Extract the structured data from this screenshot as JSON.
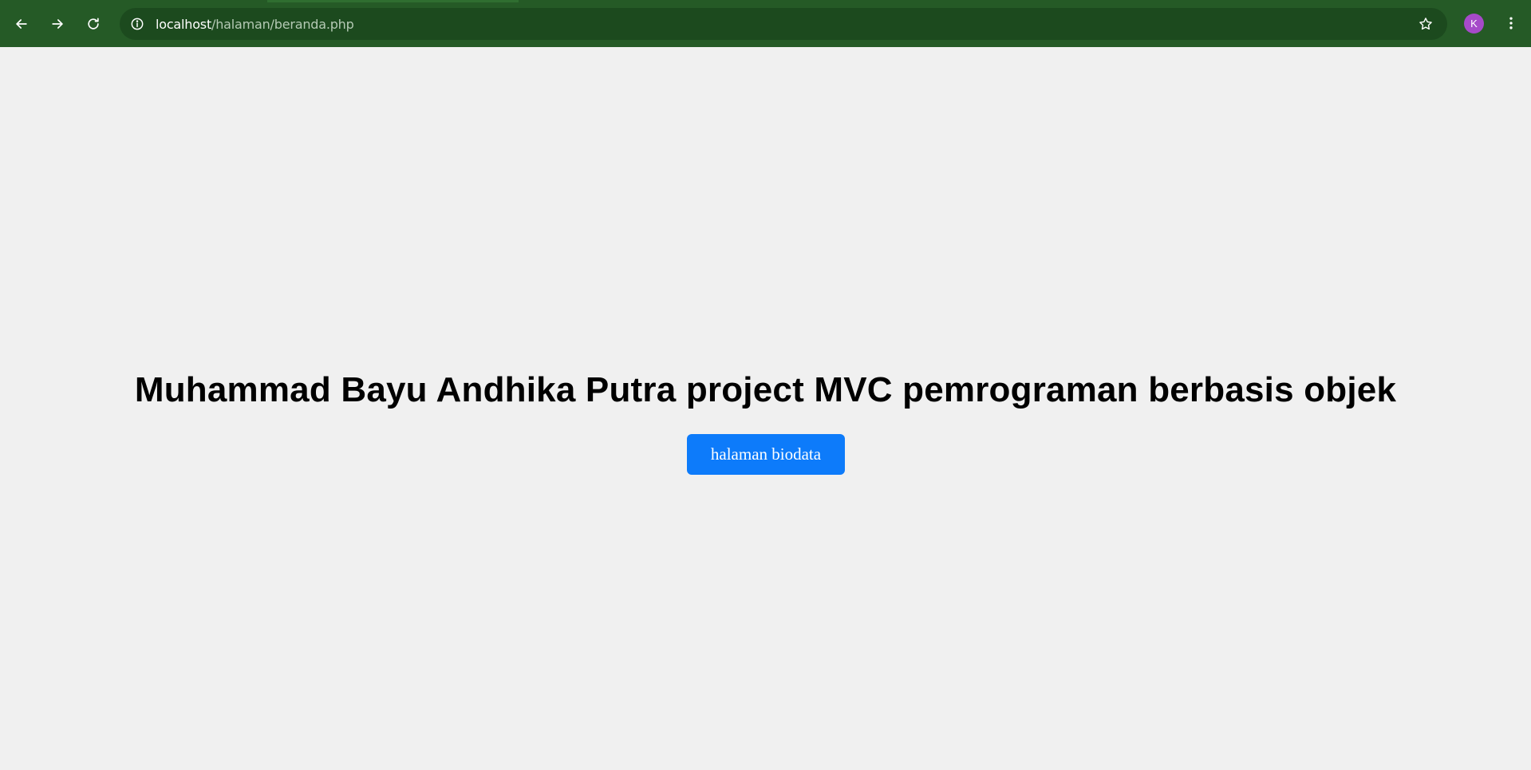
{
  "browser": {
    "url_host": "localhost",
    "url_path": "/halaman/beranda.php",
    "avatar_letter": "K",
    "icons": [
      "back-icon",
      "forward-icon",
      "reload-icon",
      "info-icon",
      "star-icon",
      "menu-icon"
    ],
    "bar_color": "#255a26",
    "avatar_color": "#a64ac9"
  },
  "page": {
    "heading": "Muhammad Bayu Andhika Putra project MVC pemrograman berbasis objek",
    "button_label": "halaman biodata",
    "button_color": "#0d7bfa",
    "background": "#f0f0f0"
  }
}
